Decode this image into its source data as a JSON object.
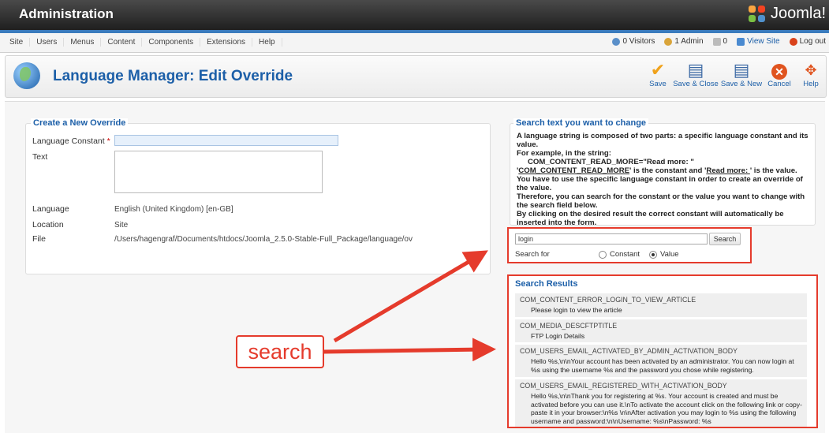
{
  "app": {
    "title": "Administration",
    "brand": "Joomla!"
  },
  "menu": {
    "items": [
      "Site",
      "Users",
      "Menus",
      "Content",
      "Components",
      "Extensions",
      "Help"
    ],
    "status": {
      "visitors": "0 Visitors",
      "admin": "1 Admin",
      "messages": "0",
      "view_site": "View Site",
      "logout": "Log out"
    }
  },
  "toolbar": {
    "page_title": "Language Manager: Edit Override",
    "buttons": {
      "save": "Save",
      "save_close": "Save & Close",
      "save_new": "Save & New",
      "cancel": "Cancel",
      "help": "Help"
    }
  },
  "form": {
    "legend": "Create a New Override",
    "language_constant_label": "Language Constant",
    "required_mark": "*",
    "language_constant_value": "",
    "text_label": "Text",
    "text_value": "",
    "language_label": "Language",
    "language_value": "English (United Kingdom) [en-GB]",
    "location_label": "Location",
    "location_value": "Site",
    "file_label": "File",
    "file_value": "/Users/hagengraf/Documents/htdocs/Joomla_2.5.0-Stable-Full_Package/language/ov"
  },
  "search": {
    "legend": "Search text you want to change",
    "help": {
      "line1": "A language string is composed of two parts: a specific language constant and its value.",
      "line2": "For example, in the string:",
      "line3": "COM_CONTENT_READ_MORE=\"Read more: \"",
      "line4_const": "COM_CONTENT_READ_MORE",
      "line4_mid": " is the constant and ",
      "line4_value": "Read more: ",
      "line4_end": " is the value.",
      "line5": "You have to use the specific language constant in order to create an override of the value.",
      "line6": "Therefore, you can search for the constant or the value you want to change with the search field below.",
      "line7": "By clicking on the desired result the correct constant will automatically be inserted into the form."
    },
    "query": "login",
    "button": "Search",
    "search_for_label": "Search for",
    "options": {
      "constant": "Constant",
      "value": "Value",
      "selected": "value"
    }
  },
  "results": {
    "legend": "Search Results",
    "items": [
      {
        "constant": "COM_CONTENT_ERROR_LOGIN_TO_VIEW_ARTICLE",
        "value": "Please login to view the article"
      },
      {
        "constant": "COM_MEDIA_DESCFTPTITLE",
        "value": "FTP Login Details"
      },
      {
        "constant": "COM_USERS_EMAIL_ACTIVATED_BY_ADMIN_ACTIVATION_BODY",
        "value": "Hello %s,\\n\\nYour account has been activated by an administrator. You can now login at %s using the username %s and the password you chose while registering."
      },
      {
        "constant": "COM_USERS_EMAIL_REGISTERED_WITH_ACTIVATION_BODY",
        "value": "Hello %s,\\n\\nThank you for registering at %s. Your account is created and must be activated before you can use it.\\nTo activate the account click on the following link or copy-paste it in your browser:\\n%s \\n\\nAfter activation you may login to %s using the following username and password:\\n\\nUsername: %s\\nPassword: %s"
      }
    ]
  },
  "annotation": {
    "label": "search",
    "color": "#e53b2c"
  },
  "colors": {
    "accent": "#1c5fa8",
    "highlight": "#e53b2c"
  }
}
